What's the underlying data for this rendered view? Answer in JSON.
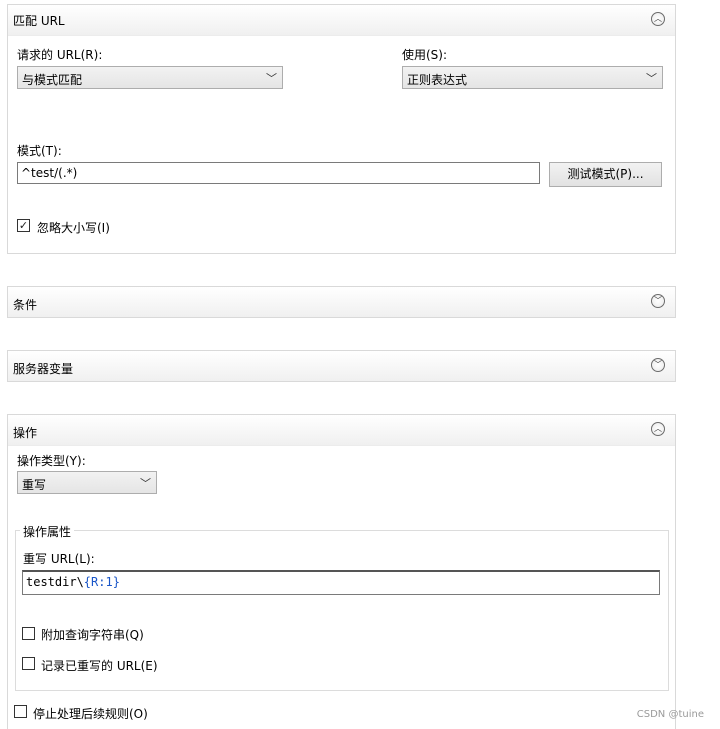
{
  "match_url": {
    "title": "匹配 URL",
    "requested_url_label": "请求的 URL(R):",
    "requested_url_value": "与模式匹配",
    "using_label": "使用(S):",
    "using_value": "正则表达式",
    "pattern_label": "模式(T):",
    "pattern_value": "^test/(.*)",
    "test_button": "测试模式(P)...",
    "ignore_case_label": "忽略大小写(I)",
    "ignore_case_checked": true
  },
  "conditions": {
    "title": "条件"
  },
  "server_variables": {
    "title": "服务器变量"
  },
  "action": {
    "title": "操作",
    "type_label": "操作类型(Y):",
    "type_value": "重写",
    "properties_title": "操作属性",
    "rewrite_url_label": "重写 URL(L):",
    "rewrite_url_plain": "testdir\\",
    "rewrite_url_token": "{R:1}",
    "append_query_label": "附加查询字符串(Q)",
    "append_query_checked": false,
    "log_rewritten_label": "记录已重写的 URL(E)",
    "log_rewritten_checked": false,
    "stop_processing_label": "停止处理后续规则(O)",
    "stop_processing_checked": false
  },
  "watermark": "CSDN @tuine",
  "icons": {
    "collapse": "chevron-up-icon",
    "expand": "chevron-down-icon",
    "dropdown": "dropdown-arrow-icon",
    "check": "checkmark-icon"
  },
  "colors": {
    "token": "#1a56c8",
    "header_bg": "#f0f0f0",
    "border": "#d9d9d9"
  }
}
